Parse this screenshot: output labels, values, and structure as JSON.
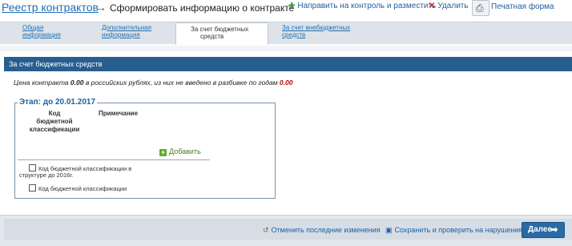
{
  "header": {
    "registry_link": "Реестр контрактов",
    "arrow": "→",
    "title": "Сформировать информацию о контракте",
    "actions": {
      "send": "Направить на контроль и разместить",
      "delete": "Удалить",
      "print": "Печатная форма"
    }
  },
  "tabs": [
    {
      "line1": "Общая",
      "line2": "информация"
    },
    {
      "line1": "Дополнительная",
      "line2": "информация"
    },
    {
      "line1": "За счет бюджетных",
      "line2": "средств"
    },
    {
      "line1": "За счет внебюджетных",
      "line2": "средств"
    }
  ],
  "section": {
    "title": "За счет бюджетных средств",
    "price_prefix": "Цена контракта ",
    "price_value": "0.00",
    "price_middle": " в российских рублях, из них не введено в разбивке по годам ",
    "price_unallocated": "0.00"
  },
  "stage": {
    "legend": "Этап: до 20.01.2017",
    "col_kbk": [
      "Код",
      "бюджетной",
      "классификации"
    ],
    "col_note": "Примечание",
    "caret": "^",
    "add_label": "Добавить",
    "checkbox1_line1": "Код бюджетной классификации в",
    "checkbox1_line2": "структуре до 2016г.",
    "checkbox2": "Код бюджетной классификации"
  },
  "footer": {
    "undo": "Отменить последние изменения",
    "save": "Сохранить и проверить на нарушения",
    "next": "Далее"
  },
  "colors": {
    "header_band": "#275e8f",
    "link": "#1f6fb5",
    "red_value": "#c00000",
    "next_button": "#2a6aa6"
  }
}
